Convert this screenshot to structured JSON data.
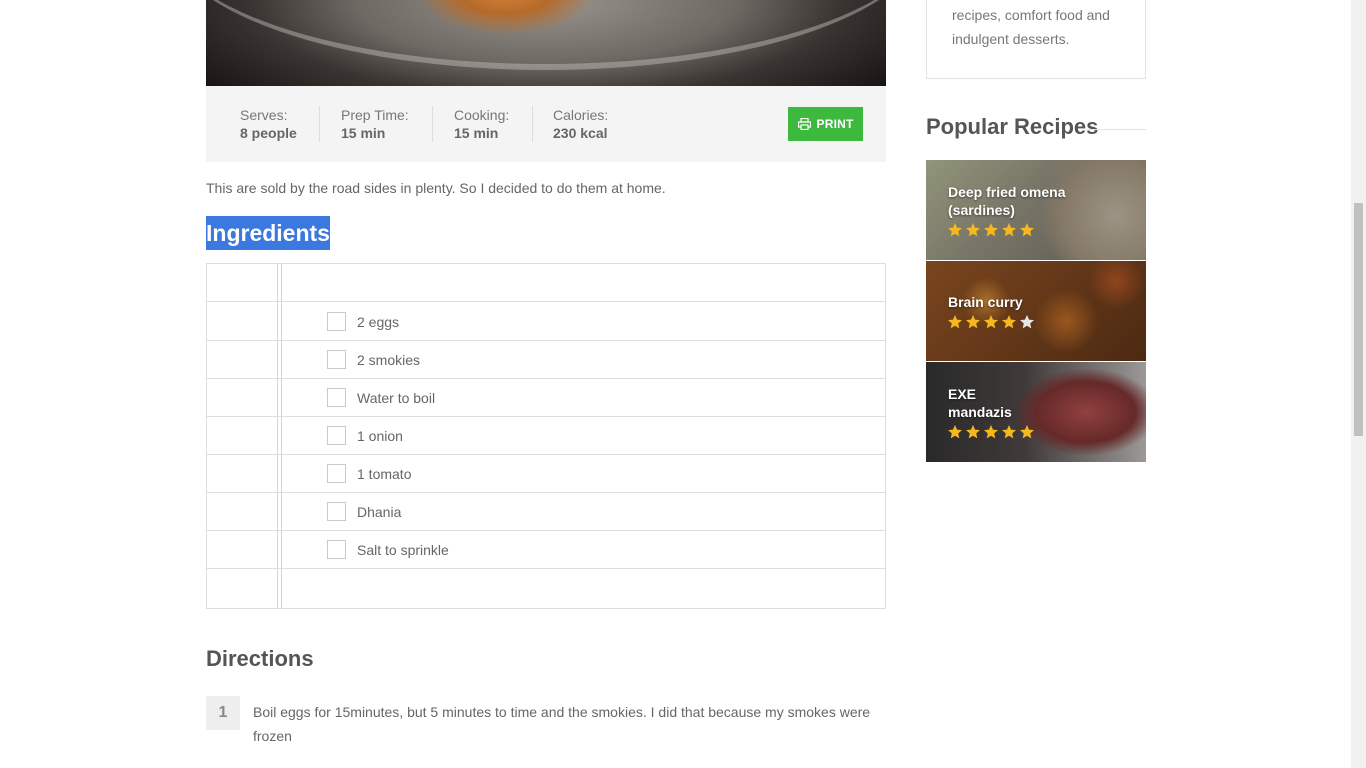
{
  "hero": {
    "prev_icon": "chevron-left-icon",
    "next_icon": "chevron-right-icon"
  },
  "info": {
    "serves_label": "Serves:",
    "serves_value": "8 people",
    "prep_label": "Prep Time:",
    "prep_value": "15 min",
    "cooking_label": "Cooking:",
    "cooking_value": "15 min",
    "calories_label": "Calories:",
    "calories_value": "230 kcal",
    "print_label": "PRINT",
    "print_icon": "printer-icon"
  },
  "intro": "This are sold by the road sides in plenty. So I decided to do them at home.",
  "ingredients": {
    "title": "Ingredients",
    "items": [
      "2 eggs",
      "2 smokies",
      "Water to boil",
      "1 onion",
      "1 tomato",
      "Dhania",
      "Salt to sprinkle"
    ]
  },
  "directions": {
    "title": "Directions",
    "steps": [
      {
        "num": "1",
        "text": "Boil eggs for 15minutes, but 5 minutes to time and the smokies. I did that because my smokes were frozen"
      }
    ]
  },
  "sidebar": {
    "about_text": "recipes, comfort food and indulgent desserts.",
    "popular_title": "Popular Recipes",
    "popular": [
      {
        "name": "Deep fried omena (sardines)",
        "rating": 5
      },
      {
        "name": "Brain curry",
        "rating": 4
      },
      {
        "name": "EXE mandazis",
        "rating": 5
      }
    ]
  },
  "colors": {
    "print_green": "#3db93d",
    "selection_blue": "#3b78e0",
    "star_gold": "#f5b820"
  }
}
